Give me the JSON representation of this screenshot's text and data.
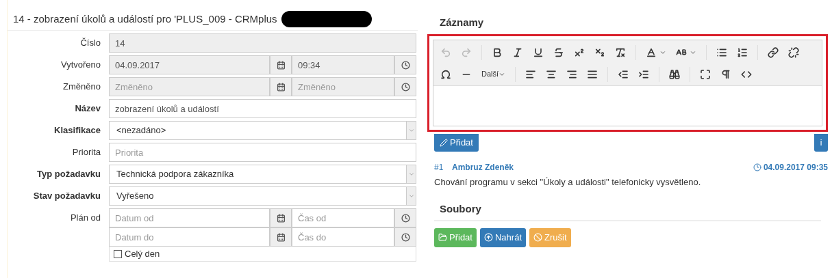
{
  "form": {
    "title": "14 - zobrazení úkolů a událostí pro 'PLUS_009 - CRMplus",
    "rows": [
      {
        "label": "Číslo",
        "required": false,
        "kind": "text",
        "readonly": true,
        "value": "14"
      },
      {
        "label": "Vytvořeno",
        "required": false,
        "kind": "datetime",
        "readonly": true,
        "date": {
          "value": "04.09.2017"
        },
        "time": {
          "value": "09:34"
        }
      },
      {
        "label": "Změněno",
        "required": false,
        "kind": "datetime",
        "readonly": true,
        "date": {
          "placeholder": "Změněno"
        },
        "time": {
          "placeholder": "Změněno"
        }
      },
      {
        "label": "Název",
        "required": true,
        "kind": "text",
        "readonly": false,
        "value": "zobrazení úkolů a událostí"
      },
      {
        "label": "Klasifikace",
        "required": true,
        "kind": "select",
        "value": "<nezadáno>"
      },
      {
        "label": "Priorita",
        "required": false,
        "kind": "text",
        "readonly": false,
        "placeholder": "Priorita"
      },
      {
        "label": "Typ požadavku",
        "required": true,
        "kind": "select",
        "value": "Technická podpora zákazníka"
      },
      {
        "label": "Stav požadavku",
        "required": true,
        "kind": "select",
        "value": "Vyřešeno"
      },
      {
        "label": "Plán od",
        "required": false,
        "kind": "range",
        "from": {
          "date": {
            "placeholder": "Datum od"
          },
          "time": {
            "placeholder": "Čas od"
          }
        },
        "to": {
          "date": {
            "placeholder": "Datum do"
          },
          "time": {
            "placeholder": "Čas do"
          }
        },
        "all_day": {
          "label": "Celý den",
          "checked": false
        }
      }
    ]
  },
  "records": {
    "title": "Záznamy",
    "toolbar": {
      "history_disabled": true,
      "more_label": "Další"
    },
    "add_button": "Přidat",
    "info_button": "i",
    "entries": [
      {
        "number": "#1",
        "author": "Ambruz Zdeněk",
        "time": "04.09.2017 09:35",
        "text": "Chování programu v sekci \"Úkoly a události\" telefonicky vysvětleno."
      }
    ]
  },
  "files": {
    "title": "Soubory",
    "buttons": [
      {
        "kind": "add",
        "label": "Přidat"
      },
      {
        "kind": "upload",
        "label": "Nahrát"
      },
      {
        "kind": "cancel",
        "label": "Zrušit"
      }
    ]
  }
}
